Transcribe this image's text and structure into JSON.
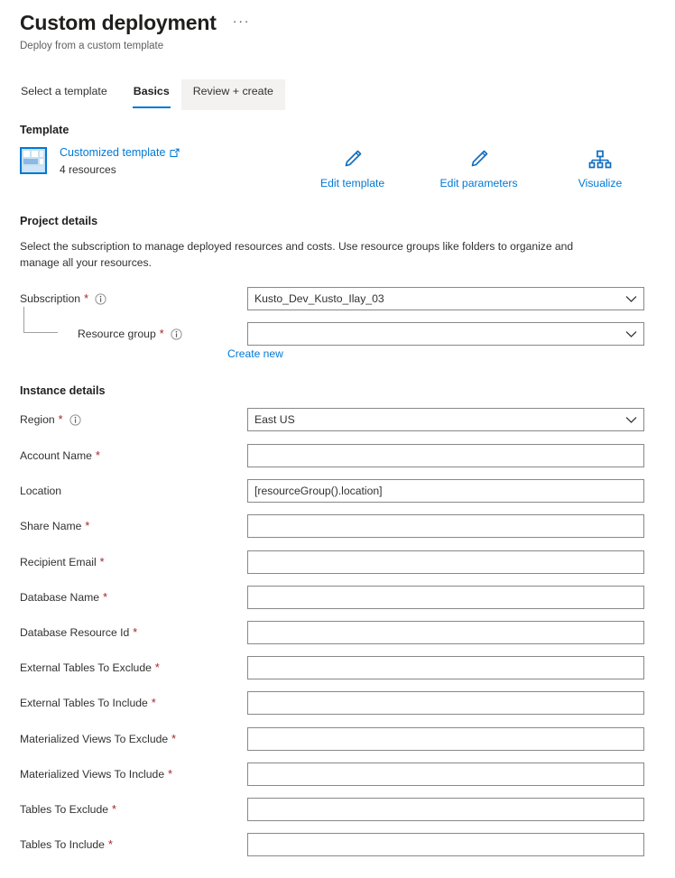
{
  "header": {
    "title": "Custom deployment",
    "subtitle": "Deploy from a custom template",
    "more_label": "···"
  },
  "tabs": [
    {
      "label": "Select a template",
      "state": "normal"
    },
    {
      "label": "Basics",
      "state": "active"
    },
    {
      "label": "Review + create",
      "state": "hovered"
    }
  ],
  "template_section": {
    "heading": "Template",
    "icon": "template-grid-icon",
    "link_label": "Customized template",
    "link_external_icon": "external-link-icon",
    "resources_count": "4 resources",
    "actions": [
      {
        "label": "Edit template",
        "icon": "pencil-icon"
      },
      {
        "label": "Edit parameters",
        "icon": "pencil-icon"
      },
      {
        "label": "Visualize",
        "icon": "hierarchy-icon"
      }
    ]
  },
  "project_details": {
    "heading": "Project details",
    "description": "Select the subscription to manage deployed resources and costs. Use resource groups like folders to organize and manage all your resources.",
    "subscription": {
      "label": "Subscription",
      "required": "*",
      "info_icon": "info-icon",
      "value": "Kusto_Dev_Kusto_Ilay_03",
      "chevron": "chevron-down-icon"
    },
    "resource_group": {
      "label": "Resource group",
      "required": "*",
      "info_icon": "info-icon",
      "value": "",
      "chevron": "chevron-down-icon",
      "create_new_label": "Create new"
    }
  },
  "instance_details": {
    "heading": "Instance details",
    "region": {
      "label": "Region",
      "required": "*",
      "info_icon": "info-icon",
      "value": "East US",
      "chevron": "chevron-down-icon"
    },
    "fields": [
      {
        "label": "Account Name",
        "required": "*",
        "value": ""
      },
      {
        "label": "Location",
        "required": "",
        "value": "[resourceGroup().location]"
      },
      {
        "label": "Share Name",
        "required": "*",
        "value": ""
      },
      {
        "label": "Recipient Email",
        "required": "*",
        "value": ""
      },
      {
        "label": "Database Name",
        "required": "*",
        "value": ""
      },
      {
        "label": "Database Resource Id",
        "required": "*",
        "value": ""
      },
      {
        "label": "External Tables To Exclude",
        "required": "*",
        "value": ""
      },
      {
        "label": "External Tables To Include",
        "required": "*",
        "value": ""
      },
      {
        "label": "Materialized Views To Exclude",
        "required": "*",
        "value": ""
      },
      {
        "label": "Materialized Views To Include",
        "required": "*",
        "value": ""
      },
      {
        "label": "Tables To Exclude",
        "required": "*",
        "value": ""
      },
      {
        "label": "Tables To Include",
        "required": "*",
        "value": ""
      }
    ]
  },
  "colors": {
    "accent": "#0078d4",
    "required_asterisk": "#a4262c",
    "text": "#323130",
    "border": "#8a8886"
  }
}
